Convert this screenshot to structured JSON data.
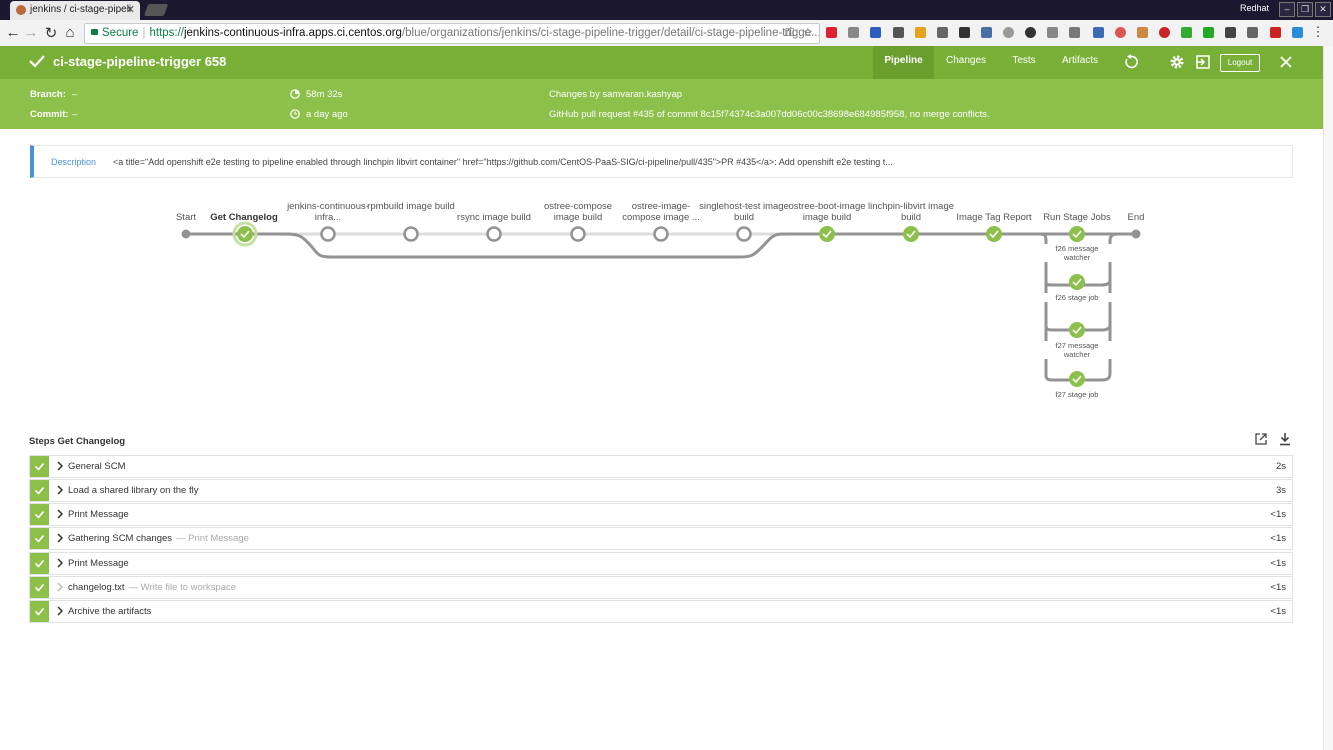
{
  "browser": {
    "tab_title": "jenkins / ci-stage-pipeli",
    "secure_label": "Secure",
    "url_scheme": "https://",
    "url_host": "jenkins-continuous-infra.apps.ci.centos.org",
    "url_path": "/blue/organizations/jenkins/ci-stage-pipeline-trigger/detail/ci-stage-pipeline-trigge...",
    "profile_label": "Redhat"
  },
  "header": {
    "title": "ci-stage-pipeline-trigger 658",
    "tabs": [
      "Pipeline",
      "Changes",
      "Tests",
      "Artifacts"
    ],
    "active_tab": "Pipeline",
    "logout_label": "Logout",
    "status_color": "#78b037"
  },
  "run_info": {
    "branch_label": "Branch:",
    "branch_value": "–",
    "commit_label": "Commit:",
    "commit_value": "–",
    "duration": "58m 32s",
    "started": "a day ago",
    "changes_by": "Changes by samvaran.kashyap",
    "cause": "GitHub pull request #435 of commit 8c15f74374c3a007dd06c00c38698e684985f958, no merge conflicts."
  },
  "description": {
    "label": "Description",
    "text": "<a title=\"Add openshift e2e testing to pipeline enabled through linchpin libvirt container\" href=\"https://github.com/CentOS-PaaS-SIG/ci-pipeline/pull/435\">PR #435</a>: Add openshift e2e testing t..."
  },
  "pipeline": {
    "stages": [
      {
        "label": "Start",
        "status": "start"
      },
      {
        "label": "Get Changelog",
        "status": "success",
        "selected": true
      },
      {
        "label": "jenkins-continuous-infra...",
        "status": "skipped"
      },
      {
        "label": "rpmbuild image build",
        "status": "skipped"
      },
      {
        "label": "rsync image build",
        "status": "skipped"
      },
      {
        "label": "ostree-compose image build",
        "status": "skipped"
      },
      {
        "label": "ostree-image-compose image ...",
        "status": "skipped"
      },
      {
        "label": "singlehost-test image build",
        "status": "skipped"
      },
      {
        "label": "ostree-boot-image image build",
        "status": "success"
      },
      {
        "label": "linchpin-libvirt image build",
        "status": "success"
      },
      {
        "label": "Image Tag Report",
        "status": "success"
      },
      {
        "label": "Run Stage Jobs",
        "status": "success"
      },
      {
        "label": "End",
        "status": "end"
      }
    ],
    "parallel": [
      {
        "label": "f26 message watcher",
        "status": "success"
      },
      {
        "label": "f26 stage job",
        "status": "success"
      },
      {
        "label": "f27 message watcher",
        "status": "success"
      },
      {
        "label": "f27 stage job",
        "status": "success"
      }
    ]
  },
  "steps": {
    "title": "Steps Get Changelog",
    "items": [
      {
        "name": "General SCM",
        "sub": "",
        "duration": "2s"
      },
      {
        "name": "Load a shared library on the fly",
        "sub": "",
        "duration": "3s"
      },
      {
        "name": "Print Message",
        "sub": "",
        "duration": "<1s"
      },
      {
        "name": "Gathering SCM changes",
        "sub": "— Print Message",
        "duration": "<1s"
      },
      {
        "name": "Print Message",
        "sub": "",
        "duration": "<1s"
      },
      {
        "name": "changelog.txt",
        "sub": "— Write file to workspace",
        "duration": "<1s"
      },
      {
        "name": "Archive the artifacts",
        "sub": "",
        "duration": "<1s"
      }
    ]
  },
  "colors": {
    "success": "#8cc04b",
    "header_green": "#78b037",
    "info_green": "#8cc04b",
    "link_blue": "#4a90d9"
  }
}
